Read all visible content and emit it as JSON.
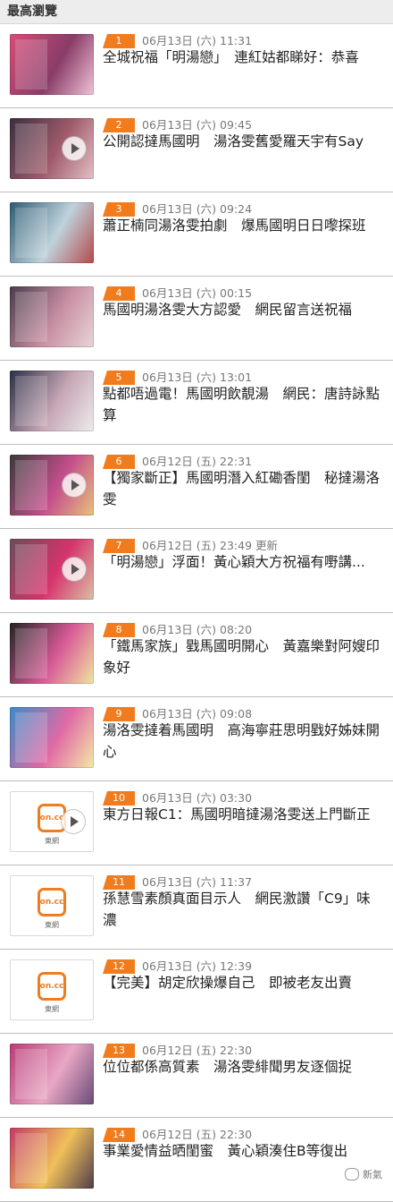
{
  "header": {
    "title": "最高瀏覽"
  },
  "items": [
    {
      "rank": "1",
      "date": "06月13日 (六) 11:31",
      "title": "全城祝福「明湯戀」　連紅姑都睇好：恭喜",
      "thumb_type": "photo",
      "thumb_colors": [
        "#d84b77",
        "#8a3c68",
        "#f0c4d8"
      ],
      "play": false
    },
    {
      "rank": "2",
      "date": "06月13日 (六) 09:45",
      "title": "公開認撻馬國明　湯洛雯舊愛羅天宇有Say",
      "thumb_type": "photo",
      "thumb_colors": [
        "#3b2e3e",
        "#9f5b6c",
        "#e5c0c6"
      ],
      "play": true
    },
    {
      "rank": "3",
      "date": "06月13日 (六) 09:24",
      "title": "蕭正楠同湯洛雯拍劇　爆馬國明日日嚟探班",
      "thumb_type": "photo",
      "thumb_colors": [
        "#2d5c73",
        "#bfd2dc",
        "#b34b4b"
      ],
      "play": false
    },
    {
      "rank": "4",
      "date": "06月13日 (六) 00:15",
      "title": "馬國明湯洛雯大方認愛　網民留言送祝福",
      "thumb_type": "photo",
      "thumb_colors": [
        "#4a3b4b",
        "#c98fa3",
        "#e7d6d8"
      ],
      "play": false
    },
    {
      "rank": "5",
      "date": "06月13日 (六) 13:01",
      "title": "點都唔過電！馬國明飲靚湯　網民：唐詩詠點算",
      "thumb_type": "photo",
      "thumb_colors": [
        "#2b2f45",
        "#c7a7b6",
        "#ececec"
      ],
      "play": false
    },
    {
      "rank": "6",
      "date": "06月12日 (五) 22:31",
      "title": "【獨家斷正】馬國明潛入紅磡香閨　秘撻湯洛雯",
      "thumb_type": "photo",
      "thumb_colors": [
        "#3a3a3a",
        "#c44e8c",
        "#e8c27b"
      ],
      "play": true
    },
    {
      "rank": "7",
      "date": "06月12日 (五) 23:49 更新",
      "title": "「明湯戀」浮面！黃心穎大方祝福有嘢講...",
      "thumb_type": "photo",
      "thumb_colors": [
        "#6b4d59",
        "#d6336c",
        "#d9c1a5"
      ],
      "play": true
    },
    {
      "rank": "8",
      "date": "06月13日 (六) 08:20",
      "title": "「鐵馬家族」戥馬國明開心　黃嘉樂對阿嫂印象好",
      "thumb_type": "photo",
      "thumb_colors": [
        "#242424",
        "#d65a96",
        "#f2e5a0"
      ],
      "play": false
    },
    {
      "rank": "9",
      "date": "06月13日 (六) 09:08",
      "title": "湯洛雯撻着馬國明　高海寧莊思明戥好姊妹開心",
      "thumb_type": "photo",
      "thumb_colors": [
        "#3a8bc9",
        "#e06aa5",
        "#f4e9a6"
      ],
      "play": false
    },
    {
      "rank": "10",
      "date": "06月13日 (六) 03:30",
      "title": "東方日報C1：馬國明暗撻湯洛雯送上門斷正",
      "thumb_type": "logo",
      "logo_text": "on.cc",
      "logo_caption": "東網",
      "play": true
    },
    {
      "rank": "11",
      "date": "06月13日 (六) 11:37",
      "title": "孫慧雪素顏真面目示人　網民激讚「C9」味濃",
      "thumb_type": "logo",
      "logo_text": "on.cc",
      "logo_caption": "東網",
      "play": false
    },
    {
      "rank": "12",
      "date": "06月13日 (六) 12:39",
      "title": "【完美】胡定欣操爆自己　即被老友出賣",
      "thumb_type": "logo",
      "logo_text": "on.cc",
      "logo_caption": "東網",
      "play": false
    },
    {
      "rank": "13",
      "date": "06月12日 (五) 22:30",
      "title": "位位都係高質素　湯洛雯緋聞男友逐個捉",
      "thumb_type": "photo",
      "thumb_colors": [
        "#b93b76",
        "#e9a7c3",
        "#6a4b78"
      ],
      "play": false
    },
    {
      "rank": "14",
      "date": "06月12日 (五) 22:30",
      "title": "事業愛情益晒閨蜜　黃心穎湊住B等復出",
      "thumb_type": "photo",
      "thumb_colors": [
        "#c43b64",
        "#f0c05a",
        "#4f3c4c"
      ],
      "play": false
    }
  ],
  "watermark": {
    "text": "新氣",
    "icon": "wechat-icon"
  },
  "colors": {
    "accent": "#f07c1e",
    "divider": "#bdbdbd",
    "header_bg": "#ededed"
  }
}
